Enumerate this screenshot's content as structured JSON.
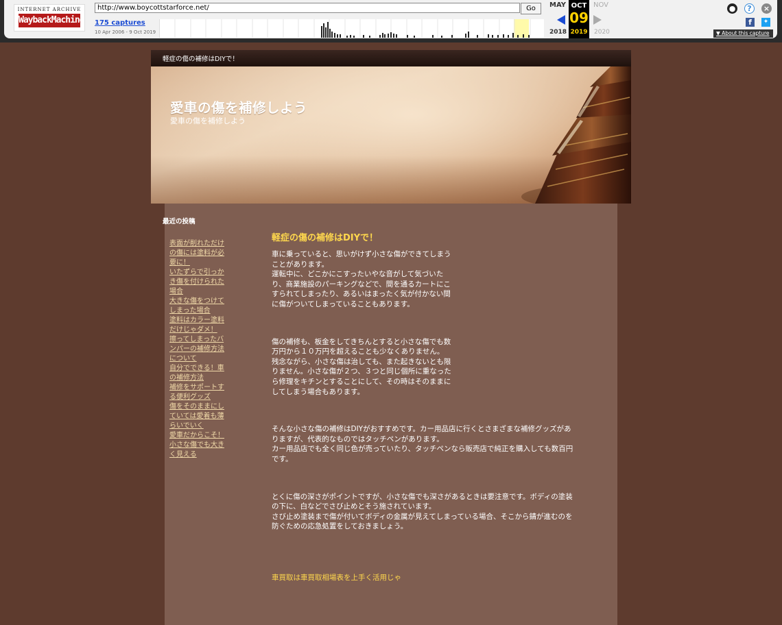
{
  "wayback": {
    "logo_top": "INTERNET ARCHIVE",
    "logo_main": "WaybackMachine",
    "url": "http://www.boycottstarforce.net/",
    "go_label": "Go",
    "captures": "175 captures",
    "range": "10 Apr 2006 - 9 Oct 2019",
    "months": {
      "prev": "MAY",
      "current": "OCT",
      "next": "NOV"
    },
    "day": "09",
    "years": {
      "prev": "2018",
      "current": "2019",
      "next": "2020"
    },
    "about": "About this capture",
    "icons": [
      "user-icon",
      "help-icon",
      "close-icon",
      "facebook-icon",
      "twitter-icon"
    ],
    "colors": {
      "accent": "#1a4bd3",
      "current_date": "#ffd200"
    }
  },
  "site": {
    "topbar_text": "軽症の傷の補修はDIYで！",
    "title": "愛車の傷を補修しよう",
    "subtitle": "愛車の傷を補修しよう",
    "colors": {
      "background": "#5e3b2e",
      "content": "#7f5e51",
      "link": "#f0d9a8",
      "accent": "#ffd84d"
    }
  },
  "sidebar": {
    "heading": "最近の投稿",
    "items": [
      [
        "表面が削れただけ",
        "の傷には塗料が必",
        "要に！"
      ],
      [
        "いたずらで引っか",
        "き傷を付けられた",
        "場合"
      ],
      [
        "大きな傷をつけて",
        "しまった場合"
      ],
      [
        "塗料はカラー塗料",
        "だけじゃダメ！"
      ],
      [
        "擦ってしまったバ",
        "ンパーの補修方法",
        "について"
      ],
      [
        "自分でできる！車",
        "の補修方法 "
      ],
      [
        "補修をサポートす",
        "る便利グッズ"
      ],
      [
        "傷をそのままにし",
        "ていては愛着も薄",
        "らいでいく"
      ],
      [
        "愛車だからこそ！",
        "小さな傷でも大き",
        "く見える "
      ]
    ]
  },
  "post": {
    "title": "軽症の傷の補修はDIYで！",
    "paragraphs": [
      [
        "車に乗っていると、思いがけず小さな傷ができてしまう",
        "ことがあります。",
        "運転中に、どこかにこすったいやな音がして気づいた",
        "り、商業施設のパーキングなどで、間を通るカートにこ",
        "すられてしまったり、あるいはまったく気が付かない間",
        "に傷がついてしまっていることもあります。"
      ],
      [
        "傷の補修も、板金をしてきちんとすると小さな傷でも数",
        "万円から１０万円を超えることも少なくありません。",
        "残念ながら、小さな傷は治しても、また起きないとも限",
        "りません。小さな傷が２つ、３つと同じ個所に重なった",
        "ら修理をキチンとすることにして、その時はそのままに",
        "してしまう場合もあります。"
      ],
      [
        "そんな小さな傷の補修はDIYがおすすめです。カー用品店に行くとさまざまな補修グッズがあ",
        "りますが、代表的なものではタッチペンがあります。",
        "カー用品店でも全く同じ色が売っていたり、タッチペンなら販売店で純正を購入しても数百円",
        "です。"
      ],
      [
        "とくに傷の深さがポイントですが、小さな傷でも深さがあるときは要注意です。ボディの塗装",
        "の下に、白などでさび止めとそう施されています。",
        "さび止め塗装まで傷が付いてボディの金属が見えてしまっている場合、そこから錆が進むのを",
        "防ぐための応急処置をしておきましょう。"
      ]
    ]
  },
  "footer_link": "車買取は車買取相場表を上手く活用じゃ"
}
